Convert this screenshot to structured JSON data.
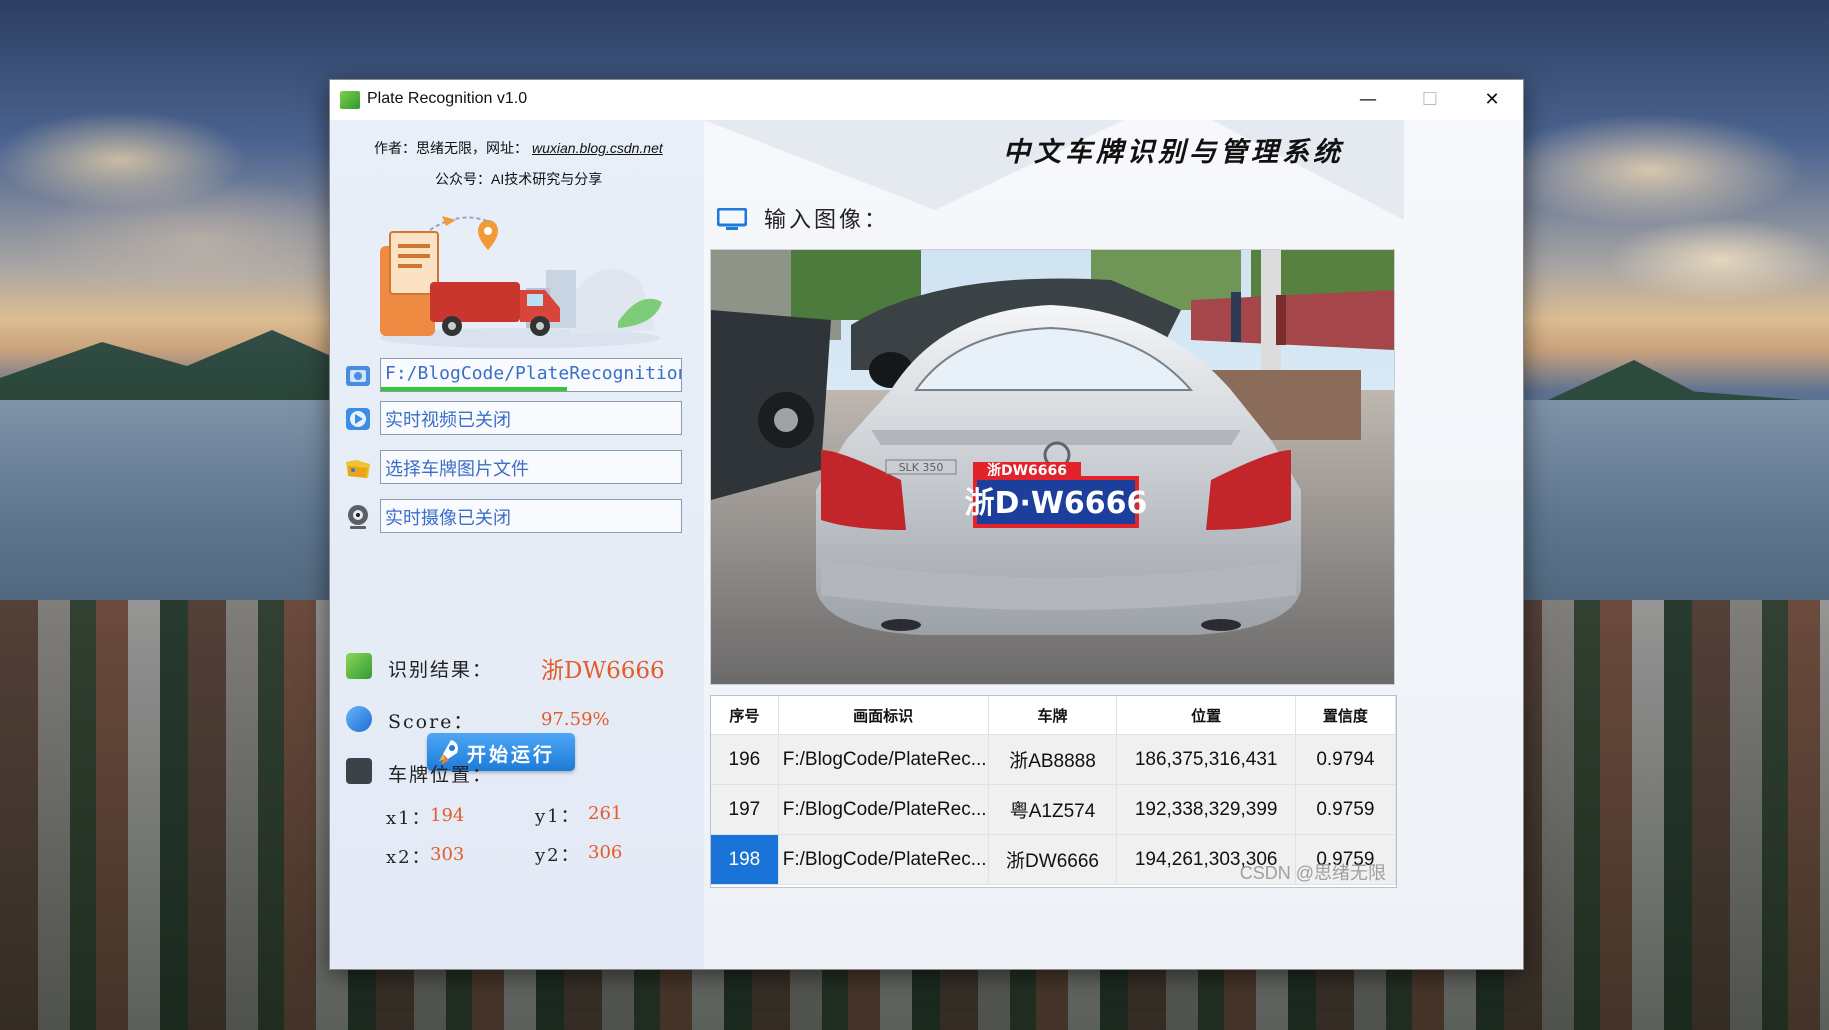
{
  "window": {
    "title": "Plate Recognition v1.0",
    "min_glyph": "—",
    "max_glyph": "☐",
    "close_glyph": "✕"
  },
  "left": {
    "author_line": "作者：思绪无限，网址：",
    "author_url": "wuxian.blog.csdn.net",
    "wechat_line": "公众号：AI技术研究与分享",
    "path_value": "F:/BlogCode/PlateRecognition",
    "path_progress": 0.62,
    "video_label": "实时视频已关闭",
    "select_file_label": "选择车牌图片文件",
    "camera_label": "实时摄像已关闭",
    "run_button_label": "开始运行",
    "result_label": "识别结果：",
    "result_value": "浙DW6666",
    "score_label": "Score：",
    "score_value": "97.59%",
    "position_label": "车牌位置：",
    "x1_label": "x1：",
    "x1_value": "194",
    "y1_label": "y1：",
    "y1_value": "261",
    "x2_label": "x2：",
    "x2_value": "303",
    "y2_label": "y2：",
    "y2_value": "306"
  },
  "right": {
    "system_title": "中文车牌识别与管理系统",
    "input_image_label": "输入图像：",
    "image": {
      "plate_tag": "浙DW6666",
      "plate_text": "浙D·W6666",
      "car_badge": "SLK 350"
    },
    "table": {
      "headers": [
        "序号",
        "画面标识",
        "车牌",
        "位置",
        "置信度"
      ],
      "rows": [
        {
          "index": "196",
          "path": "F:/BlogCode/PlateRec...",
          "plate": "浙AB8888",
          "position": "186,375,316,431",
          "confidence": "0.9794"
        },
        {
          "index": "197",
          "path": "F:/BlogCode/PlateRec...",
          "plate": "粤A1Z574",
          "position": "192,338,329,399",
          "confidence": "0.9759"
        },
        {
          "index": "198",
          "path": "F:/BlogCode/PlateRec...",
          "plate": "浙DW6666",
          "position": "194,261,303,306",
          "confidence": "0.9759"
        }
      ]
    }
  },
  "watermark": "CSDN @思绪无限",
  "icons": [
    "app-icon",
    "folder-icon",
    "video-icon",
    "image-file-icon",
    "camera-icon",
    "rocket-icon",
    "result-icon",
    "score-icon",
    "position-icon",
    "monitor-icon"
  ],
  "colors": {
    "accent": "#1a73d6",
    "result_value": "#e55b2a",
    "path_text": "#3a6fc8",
    "progress": "#3ac43a"
  }
}
